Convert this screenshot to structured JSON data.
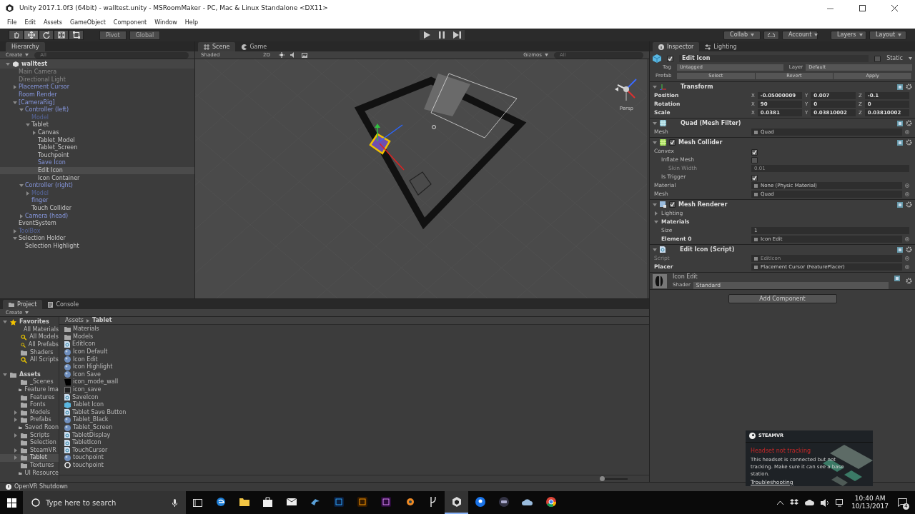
{
  "window": {
    "title": "Unity 2017.1.0f3 (64bit) - walltest.unity - MSRoomMaker - PC, Mac & Linux Standalone <DX11>"
  },
  "menu": [
    "File",
    "Edit",
    "Assets",
    "GameObject",
    "Component",
    "Window",
    "Help"
  ],
  "toolbar": {
    "tools": [
      {
        "kind": "hand",
        "selected": false
      },
      {
        "kind": "move",
        "selected": true
      },
      {
        "kind": "rotate",
        "selected": false
      },
      {
        "kind": "scale",
        "selected": false
      },
      {
        "kind": "rect",
        "selected": false
      }
    ],
    "pivot": "Pivot",
    "space": "Global",
    "playback": [
      {
        "kind": "play",
        "selected": false
      },
      {
        "kind": "pause",
        "selected": false
      },
      {
        "kind": "step",
        "selected": false
      }
    ],
    "collab": "Collab",
    "account": "Account",
    "layers": "Layers",
    "layout": "Layout"
  },
  "hierarchy": {
    "tab": "Hierarchy",
    "create": "Create",
    "search_placeholder": "All",
    "scene": "walltest",
    "items": [
      {
        "label": "Main Camera",
        "kind": "leaf",
        "prefab": false,
        "active": false,
        "selected": false
      },
      {
        "label": "Directional Light",
        "kind": "leaf",
        "prefab": false,
        "active": false,
        "selected": false
      },
      {
        "label": "Placement Cursor",
        "kind": "collapsed",
        "prefab": true,
        "active": true,
        "selected": false
      },
      {
        "label": "Room Render",
        "kind": "leaf",
        "prefab": true,
        "active": true,
        "selected": false
      },
      {
        "label": "[CameraRig]",
        "kind": "expanded",
        "prefab": true,
        "active": true,
        "selected": false,
        "children": [
          {
            "label": "Controller (left)",
            "kind": "expanded",
            "prefab": true,
            "active": true,
            "selected": false,
            "children": [
              {
                "label": "Model",
                "kind": "leaf",
                "prefab": true,
                "active": false,
                "selected": false
              },
              {
                "label": "Tablet",
                "kind": "expanded",
                "prefab": false,
                "active": true,
                "selected": false,
                "children": [
                  {
                    "label": "Canvas",
                    "kind": "collapsed",
                    "prefab": false,
                    "active": true,
                    "selected": false
                  },
                  {
                    "label": "Tablet_Model",
                    "kind": "leaf",
                    "prefab": false,
                    "active": true,
                    "selected": false
                  },
                  {
                    "label": "Tablet_Screen",
                    "kind": "leaf",
                    "prefab": false,
                    "active": true,
                    "selected": false
                  },
                  {
                    "label": "Touchpoint",
                    "kind": "leaf",
                    "prefab": false,
                    "active": true,
                    "selected": false
                  },
                  {
                    "label": "Save Icon",
                    "kind": "leaf",
                    "prefab": true,
                    "active": true,
                    "selected": false
                  },
                  {
                    "label": "Edit Icon",
                    "kind": "leaf",
                    "prefab": false,
                    "active": true,
                    "selected": true
                  },
                  {
                    "label": "Icon Container",
                    "kind": "leaf",
                    "prefab": false,
                    "active": true,
                    "selected": false
                  }
                ]
              }
            ]
          },
          {
            "label": "Controller (right)",
            "kind": "expanded",
            "prefab": true,
            "active": true,
            "selected": false,
            "children": [
              {
                "label": "Model",
                "kind": "collapsed",
                "prefab": true,
                "active": false,
                "selected": false
              },
              {
                "label": "finger",
                "kind": "leaf",
                "prefab": true,
                "active": true,
                "selected": false
              },
              {
                "label": "Touch Collider",
                "kind": "leaf",
                "prefab": false,
                "active": true,
                "selected": false
              }
            ]
          },
          {
            "label": "Camera (head)",
            "kind": "collapsed",
            "prefab": true,
            "active": true,
            "selected": false
          }
        ]
      },
      {
        "label": "EventSystem",
        "kind": "leaf",
        "prefab": false,
        "active": true,
        "selected": false
      },
      {
        "label": "ToolBox",
        "kind": "collapsed",
        "prefab": true,
        "active": false,
        "selected": false
      },
      {
        "label": "Selection Holder",
        "kind": "expanded",
        "prefab": false,
        "active": true,
        "selected": false,
        "children": [
          {
            "label": "Selection Highlight",
            "kind": "leaf",
            "prefab": false,
            "active": true,
            "selected": false
          }
        ]
      }
    ]
  },
  "scene": {
    "tabs": [
      {
        "label": "Scene",
        "kind": "scene",
        "selected": true
      },
      {
        "label": "Game",
        "kind": "game",
        "selected": false
      }
    ],
    "shading": "Shaded",
    "mode_2d": "2D",
    "gizmos": "Gizmos",
    "search_placeholder": "All",
    "projection": "Persp"
  },
  "inspector": {
    "tabs": [
      {
        "label": "Inspector",
        "kind": "info",
        "selected": true
      },
      {
        "label": "Lighting",
        "kind": "lighting",
        "selected": false
      }
    ],
    "object": {
      "name": "Edit Icon",
      "active": true,
      "static": false,
      "static_label": "Static",
      "tag_label": "Tag",
      "tag": "Untagged",
      "layer_label": "Layer",
      "layer": "Default",
      "prefab_label": "Prefab",
      "prefab_buttons": [
        "Select",
        "Revert",
        "Apply"
      ]
    },
    "components": [
      {
        "title": "Transform",
        "kind": "transform",
        "rows": [
          {
            "kind": "vector3",
            "label": "Position",
            "overridden": true,
            "disabled": false,
            "axes": [
              {
                "axis": "X",
                "value": "-0.05000009"
              },
              {
                "axis": "Y",
                "value": "0.007"
              },
              {
                "axis": "Z",
                "value": "-0.1"
              }
            ]
          },
          {
            "kind": "vector3",
            "label": "Rotation",
            "overridden": true,
            "disabled": false,
            "axes": [
              {
                "axis": "X",
                "value": "90"
              },
              {
                "axis": "Y",
                "value": "0"
              },
              {
                "axis": "Z",
                "value": "0"
              }
            ]
          },
          {
            "kind": "vector3",
            "label": "Scale",
            "overridden": true,
            "disabled": false,
            "axes": [
              {
                "axis": "X",
                "value": "0.0381"
              },
              {
                "axis": "Y",
                "value": "0.03810002"
              },
              {
                "axis": "Z",
                "value": "0.03810002"
              }
            ]
          }
        ]
      },
      {
        "title": "Quad (Mesh Filter)",
        "kind": "mesh_filter",
        "rows": [
          {
            "kind": "object",
            "label": "Mesh",
            "overridden": false,
            "disabled": false,
            "value": "Quad"
          }
        ]
      },
      {
        "title": "Mesh Collider",
        "kind": "mesh_collider",
        "enabled": true,
        "rows": [
          {
            "kind": "toggle",
            "label": "Convex",
            "overridden": false,
            "disabled": false,
            "checked": true,
            "children": [
              {
                "kind": "toggle",
                "label": "Inflate Mesh",
                "overridden": false,
                "disabled": false,
                "checked": false,
                "children": [
                  {
                    "kind": "float",
                    "label": "Skin Width",
                    "overridden": false,
                    "disabled": true,
                    "value": "0.01"
                  }
                ]
              },
              {
                "kind": "toggle",
                "label": "Is Trigger",
                "overridden": false,
                "disabled": false,
                "checked": true
              }
            ]
          },
          {
            "kind": "object",
            "label": "Material",
            "overridden": false,
            "disabled": false,
            "value": "None (Physic Material)"
          },
          {
            "kind": "object",
            "label": "Mesh",
            "overridden": false,
            "disabled": false,
            "value": "Quad"
          }
        ]
      },
      {
        "title": "Mesh Renderer",
        "kind": "mesh_renderer",
        "enabled": true,
        "rows": [
          {
            "kind": "foldout",
            "label": "Lighting",
            "overridden": false,
            "disabled": false,
            "expanded": false
          },
          {
            "kind": "foldout",
            "label": "Materials",
            "overridden": true,
            "disabled": false,
            "expanded": true,
            "children": [
              {
                "kind": "float",
                "label": "Size",
                "overridden": false,
                "disabled": false,
                "value": "1"
              },
              {
                "kind": "object",
                "label": "Element 0",
                "overridden": true,
                "disabled": false,
                "value": "Icon Edit"
              }
            ]
          }
        ]
      },
      {
        "title": "Edit Icon (Script)",
        "kind": "script",
        "rows": [
          {
            "kind": "object",
            "label": "Script",
            "overridden": false,
            "disabled": true,
            "value": "EditIcon"
          },
          {
            "kind": "object",
            "label": "Placer",
            "overridden": true,
            "disabled": false,
            "value": "Placement Cursor (FeaturePlacer)"
          }
        ]
      }
    ],
    "material": {
      "name": "Icon Edit",
      "shader_label": "Shader",
      "shader": "Standard"
    },
    "add_component": "Add Component"
  },
  "project": {
    "tabs": [
      {
        "label": "Project",
        "kind": "project",
        "selected": true
      },
      {
        "label": "Console",
        "kind": "console",
        "selected": false
      }
    ],
    "create": "Create",
    "favorites": {
      "label": "Favorites",
      "items": [
        {
          "label": "All Materials",
          "kind": "search"
        },
        {
          "label": "All Models",
          "kind": "search"
        },
        {
          "label": "All Prefabs",
          "kind": "search"
        },
        {
          "label": "Shaders",
          "kind": "folder"
        },
        {
          "label": "All Scripts",
          "kind": "search"
        }
      ]
    },
    "assets": {
      "label": "Assets",
      "items": [
        {
          "label": "_Scenes",
          "kind": "leaf",
          "selected": false
        },
        {
          "label": "Feature Ima",
          "kind": "leaf",
          "selected": false
        },
        {
          "label": "Features",
          "kind": "leaf",
          "selected": false
        },
        {
          "label": "Fonts",
          "kind": "leaf",
          "selected": false
        },
        {
          "label": "Models",
          "kind": "collapsed",
          "selected": false
        },
        {
          "label": "Prefabs",
          "kind": "collapsed",
          "selected": false
        },
        {
          "label": "Saved Roon",
          "kind": "leaf",
          "selected": false
        },
        {
          "label": "Scripts",
          "kind": "collapsed",
          "selected": false
        },
        {
          "label": "Selection",
          "kind": "leaf",
          "selected": false
        },
        {
          "label": "SteamVR",
          "kind": "collapsed",
          "selected": false
        },
        {
          "label": "Tablet",
          "kind": "collapsed",
          "selected": true
        },
        {
          "label": "Textures",
          "kind": "leaf",
          "selected": false
        },
        {
          "label": "UI Resource",
          "kind": "leaf",
          "selected": false
        }
      ]
    },
    "breadcrumb": [
      "Assets",
      "Tablet"
    ],
    "files": [
      {
        "label": "Materials",
        "kind": "folder"
      },
      {
        "label": "Models",
        "kind": "folder"
      },
      {
        "label": "EditIcon",
        "kind": "script"
      },
      {
        "label": "Icon Default",
        "kind": "material"
      },
      {
        "label": "Icon Edit",
        "kind": "material"
      },
      {
        "label": "Icon Highlight",
        "kind": "material"
      },
      {
        "label": "Icon Save",
        "kind": "material"
      },
      {
        "label": "icon_mode_wall",
        "kind": "texture_dark"
      },
      {
        "label": "icon_save",
        "kind": "texture_outline"
      },
      {
        "label": "SaveIcon",
        "kind": "script"
      },
      {
        "label": "Tablet Icon",
        "kind": "prefab"
      },
      {
        "label": "Tablet Save Button",
        "kind": "script"
      },
      {
        "label": "Tablet_Black",
        "kind": "material"
      },
      {
        "label": "Tablet_Screen",
        "kind": "material"
      },
      {
        "label": "TabletDisplay",
        "kind": "script"
      },
      {
        "label": "TabletIcon",
        "kind": "script"
      },
      {
        "label": "TouchCursor",
        "kind": "script"
      },
      {
        "label": "touchpoint",
        "kind": "material"
      },
      {
        "label": "touchpoint",
        "kind": "ring"
      }
    ],
    "icon_size": {
      "level": 0.05
    }
  },
  "status_bar": "OpenVR Shutdown",
  "notification": {
    "brand": "STEAMVR",
    "title": "Headset not tracking",
    "body": "This headset is connected but not tracking. Make sure it can see a base station.",
    "link": "Troubleshooting"
  },
  "taskbar": {
    "search_placeholder": "Type here to search",
    "apps": [
      {
        "kind": "edge",
        "selected": false
      },
      {
        "kind": "explorer",
        "selected": false
      },
      {
        "kind": "store",
        "selected": false
      },
      {
        "kind": "mail",
        "selected": false
      },
      {
        "kind": "steam",
        "selected": false
      },
      {
        "kind": "photoshop",
        "selected": false
      },
      {
        "kind": "illustrator",
        "selected": false
      },
      {
        "kind": "premiere",
        "selected": false
      },
      {
        "kind": "blender",
        "selected": false
      },
      {
        "kind": "git",
        "selected": false
      },
      {
        "kind": "unity",
        "selected": true
      },
      {
        "kind": "pin",
        "selected": false
      },
      {
        "kind": "vr",
        "selected": false
      },
      {
        "kind": "cloud",
        "selected": false
      },
      {
        "kind": "chrome",
        "selected": false
      }
    ],
    "time": "10:40 AM",
    "date": "10/13/2017",
    "notifications": "4"
  }
}
